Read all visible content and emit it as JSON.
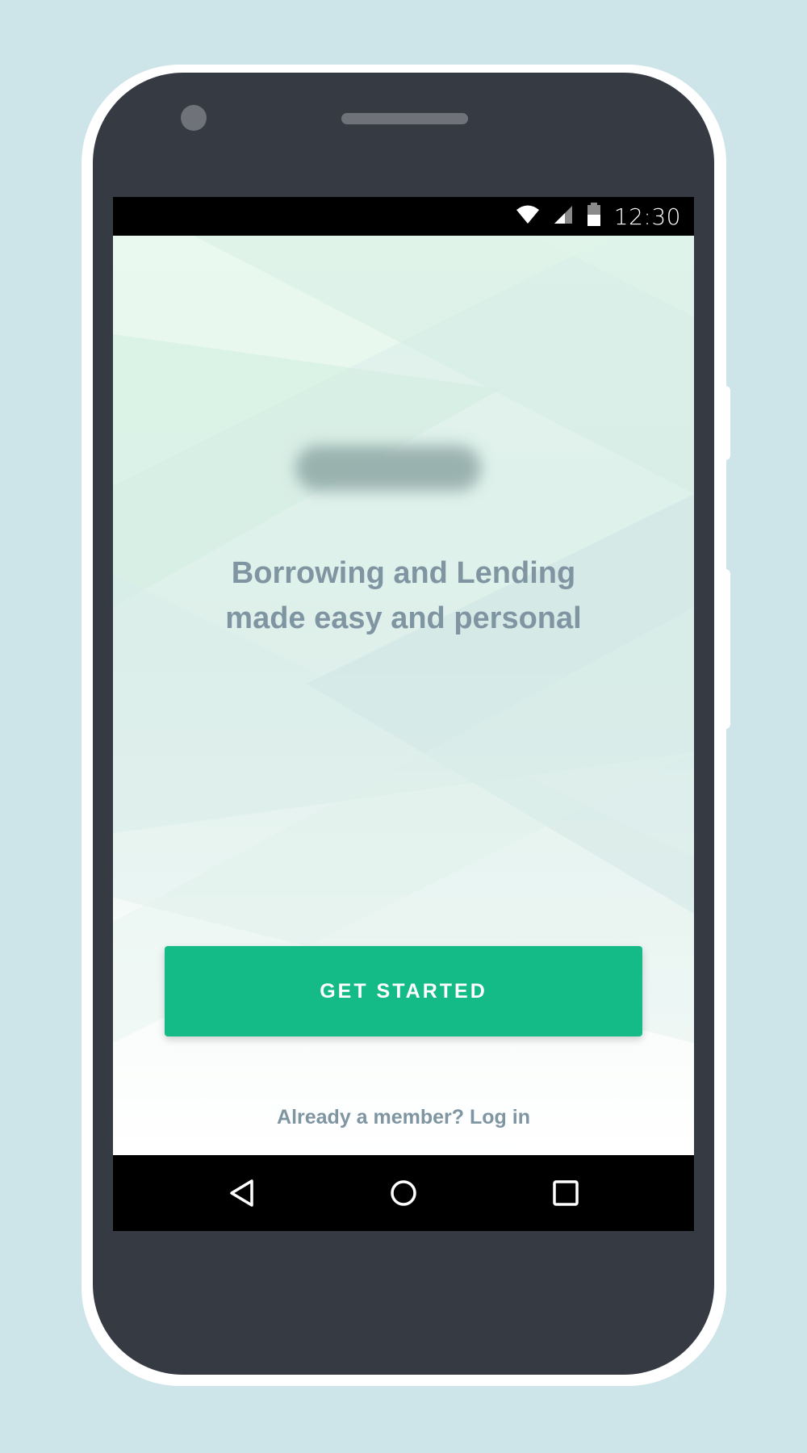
{
  "status_bar": {
    "time": "12:30",
    "icons": [
      "wifi-icon",
      "cell-signal-icon",
      "battery-icon"
    ]
  },
  "main": {
    "logo": "blurred-logo",
    "tagline_line1": "Borrowing and Lending",
    "tagline_line2": "made easy and personal",
    "cta_label": "GET STARTED",
    "login_text": "Already a member? Log in"
  },
  "nav_bar": {
    "icons": [
      "back-icon",
      "home-icon",
      "recents-icon"
    ]
  },
  "colors": {
    "background": "#cde4e8",
    "device": "#353a43",
    "accent": "#15bb87",
    "text_muted": "#7f95a2"
  }
}
